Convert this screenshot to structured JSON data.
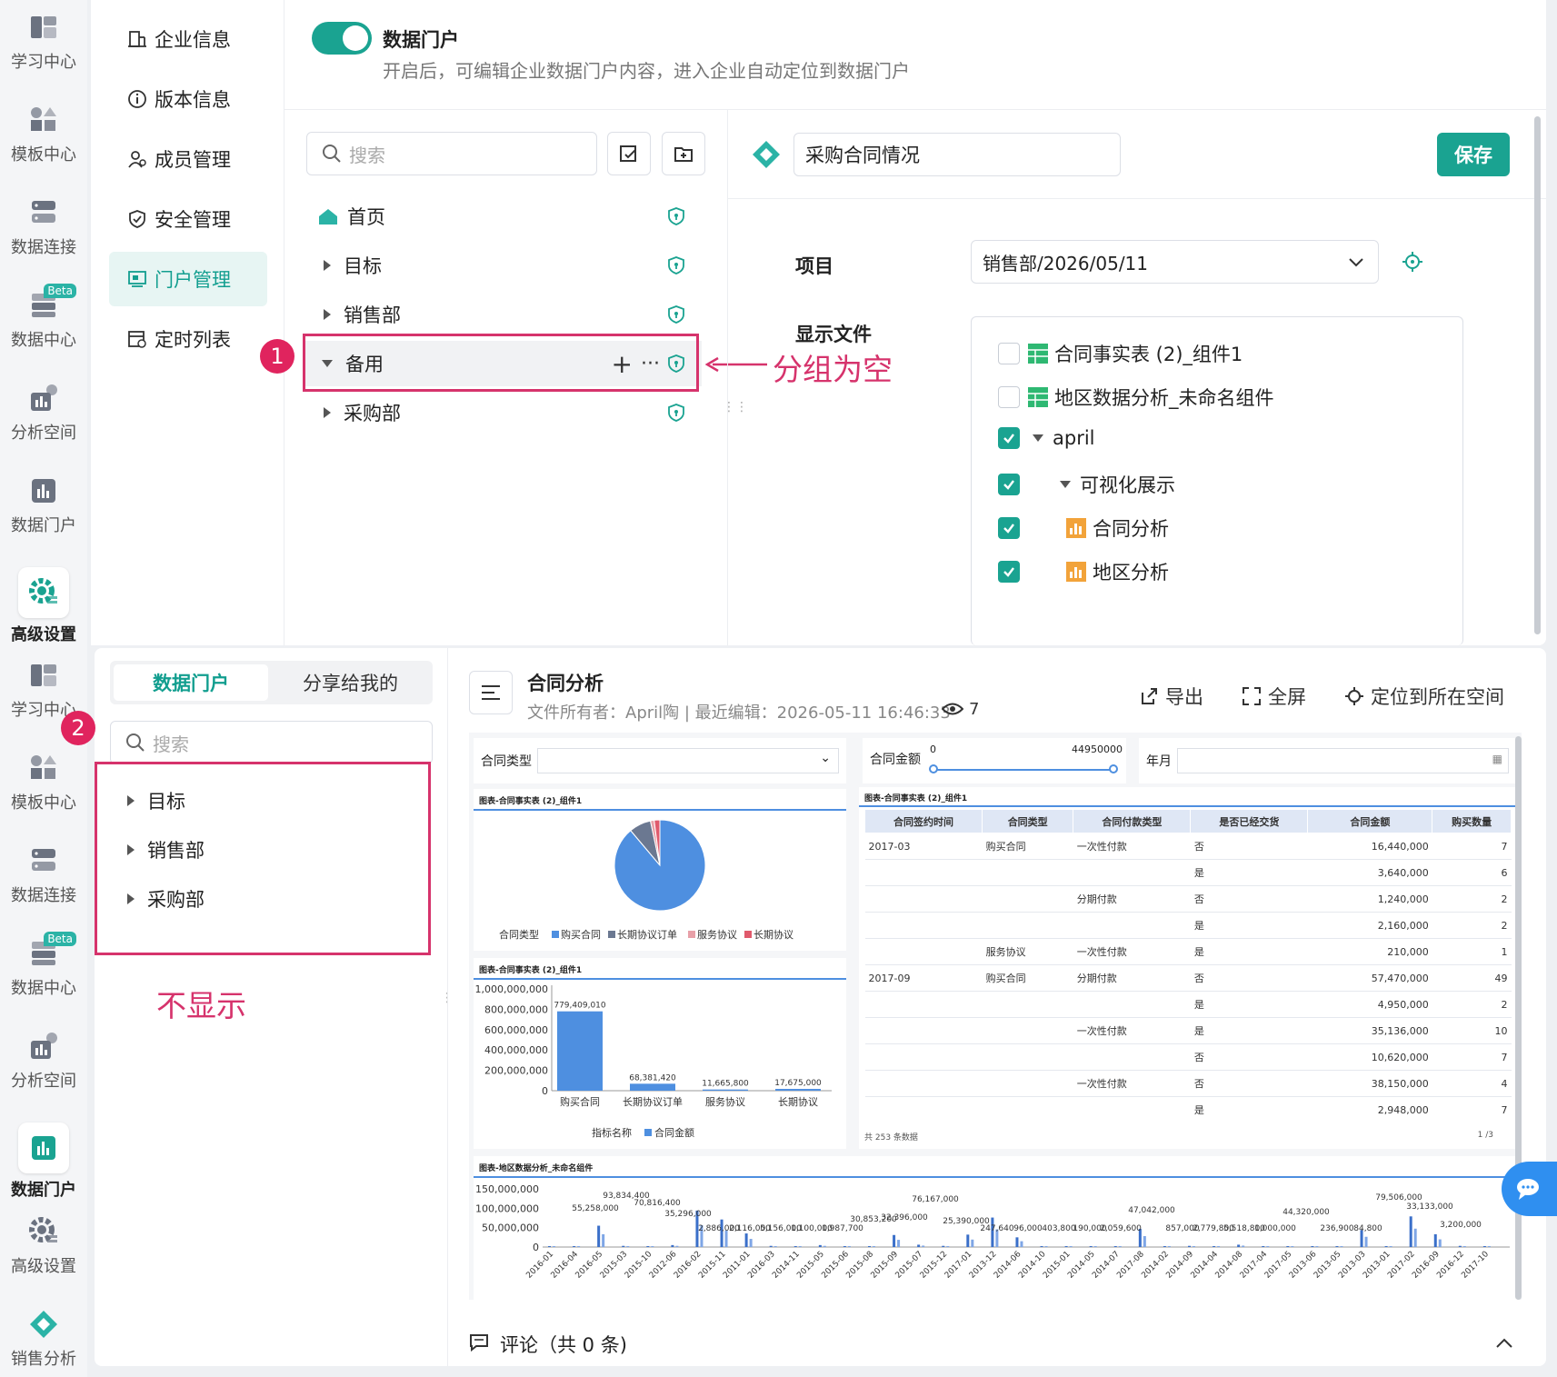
{
  "left_nav_top": [
    {
      "label": "学习中心",
      "icon": "book-icon"
    },
    {
      "label": "模板中心",
      "icon": "template-icon"
    },
    {
      "label": "数据连接",
      "icon": "database-icon"
    },
    {
      "label": "数据中心",
      "icon": "data-center-icon",
      "badge": "Beta"
    },
    {
      "label": "分析空间",
      "icon": "chart-icon"
    },
    {
      "label": "数据门户",
      "icon": "portal-icon"
    },
    {
      "label": "高级设置",
      "icon": "gear-icon"
    }
  ],
  "left_nav_bottom": [
    {
      "label": "学习中心",
      "icon": "book-icon"
    },
    {
      "label": "模板中心",
      "icon": "template-icon"
    },
    {
      "label": "数据连接",
      "icon": "database-icon"
    },
    {
      "label": "数据中心",
      "icon": "data-center-icon",
      "badge": "Beta"
    },
    {
      "label": "分析空间",
      "icon": "chart-icon"
    },
    {
      "label": "数据门户",
      "icon": "portal-icon"
    },
    {
      "label": "高级设置",
      "icon": "gear-icon"
    },
    {
      "label": "销售分析",
      "icon": "diamond-icon"
    }
  ],
  "settings_menu": [
    {
      "label": "企业信息",
      "icon": "building-icon"
    },
    {
      "label": "版本信息",
      "icon": "info-icon"
    },
    {
      "label": "成员管理",
      "icon": "user-icon"
    },
    {
      "label": "安全管理",
      "icon": "shield-icon"
    },
    {
      "label": "门户管理",
      "icon": "portal-icon"
    },
    {
      "label": "定时列表",
      "icon": "calendar-icon"
    }
  ],
  "portal_toggle": {
    "title": "数据门户",
    "desc": "开启后，可编辑企业数据门户内容，进入企业自动定位到数据门户"
  },
  "tree_search_placeholder": "搜索",
  "tree": [
    {
      "label": "首页"
    },
    {
      "label": "目标"
    },
    {
      "label": "销售部"
    },
    {
      "label": "备用"
    },
    {
      "label": "采购部"
    }
  ],
  "annotation1": {
    "num": "1",
    "text": "分组为空"
  },
  "page_name": "采购合同情况",
  "save_label": "保存",
  "project_label": "项目",
  "project_value": "销售部/2026/05/11",
  "display_files_label": "显示文件",
  "files": [
    {
      "label": "合同事实表 (2)_组件1",
      "checked": false
    },
    {
      "label": "地区数据分析_未命名组件",
      "checked": false
    },
    {
      "label": "april",
      "checked": true
    },
    {
      "label": "可视化展示",
      "checked": true
    },
    {
      "label": "合同分析",
      "checked": true
    },
    {
      "label": "地区分析",
      "checked": true
    }
  ],
  "portal_tabs": [
    "数据门户",
    "分享给我的"
  ],
  "portal_search_placeholder": "搜索",
  "portal_tree": [
    "目标",
    "销售部",
    "采购部"
  ],
  "annotation2": {
    "num": "2",
    "text": "不显示"
  },
  "report": {
    "title": "合同分析",
    "meta": "文件所有者：April陶 | 最近编辑：2026-05-11 16:46:33",
    "views": "7",
    "export": "导出",
    "fullscreen": "全屏",
    "locate": "定位到所在空间",
    "comment": "评论（共 0 条)"
  },
  "filters": {
    "type_label": "合同类型",
    "amount_label": "合同金额",
    "amount_min": "0",
    "amount_max": "44950000",
    "month_label": "年月"
  },
  "pie_chart": {
    "title": "图表-合同事实表 (2)_组件1",
    "legend_title": "合同类型",
    "chart_data": {
      "type": "pie",
      "labels": [
        "购买合同",
        "长期协议订单",
        "服务协议",
        "长期协议"
      ],
      "values": [
        779409010,
        68381420,
        11665800,
        17675000
      ],
      "colors": [
        "#4e8fe0",
        "#6b7891",
        "#e8a0a8",
        "#e05a6c"
      ]
    }
  },
  "bar_chart": {
    "title": "图表-合同事实表 (2)_组件1",
    "legend_x": "指标名称",
    "legend_series": "合同金额",
    "y_ticks": [
      "1,000,000,000",
      "800,000,000",
      "600,000,000",
      "400,000,000",
      "200,000,000",
      "0"
    ],
    "value_labels": [
      "779,409,010",
      "68,381,420",
      "11,665,800",
      "17,675,000"
    ],
    "chart_data": {
      "type": "bar",
      "categories": [
        "购买合同",
        "长期协议订单",
        "服务协议",
        "长期协议"
      ],
      "values": [
        779409010,
        68381420,
        11665800,
        17675000
      ],
      "ylim": [
        0,
        1000000000
      ]
    }
  },
  "table": {
    "title": "图表-合同事实表 (2)_组件1",
    "headers": [
      "合同签约时间",
      "合同类型",
      "合同付款类型",
      "是否已经交货",
      "合同金额",
      "购买数量"
    ],
    "rows": [
      [
        "2017-03",
        "购买合同",
        "一次性付款",
        "否",
        "16,440,000",
        "7"
      ],
      [
        "",
        "",
        "",
        "是",
        "3,640,000",
        "6"
      ],
      [
        "",
        "",
        "分期付款",
        "否",
        "1,240,000",
        "2"
      ],
      [
        "",
        "",
        "",
        "是",
        "2,160,000",
        "2"
      ],
      [
        "",
        "服务协议",
        "一次性付款",
        "是",
        "210,000",
        "1"
      ],
      [
        "2017-09",
        "购买合同",
        "分期付款",
        "否",
        "57,470,000",
        "49"
      ],
      [
        "",
        "",
        "",
        "是",
        "4,950,000",
        "2"
      ],
      [
        "",
        "",
        "一次性付款",
        "是",
        "35,136,000",
        "10"
      ],
      [
        "",
        "",
        "",
        "否",
        "10,620,000",
        "7"
      ],
      [
        "",
        "",
        "一次性付款",
        "否",
        "38,150,000",
        "4"
      ],
      [
        "",
        "",
        "",
        "是",
        "2,948,000",
        "7"
      ]
    ],
    "footer": "共 253 条数据",
    "pager": "1 /3"
  },
  "region_chart": {
    "title": "图表-地区数据分析_未命名组件",
    "y_ticks": [
      "150,000,000",
      "100,000,000",
      "50,000,000",
      "0"
    ],
    "value_labels": [
      "55,258,000",
      "93,834,400",
      "70,816,400",
      "35,296,000",
      "2,886,000",
      "2,116,000",
      "5,156,000",
      "1,100,000",
      "1,987,700",
      "30,853,200",
      "32,396,000",
      "76,167,000",
      "25,390,000",
      "247,640",
      "96,000",
      "403,800",
      "190,000",
      "2,059,600",
      "47,042,000",
      "857,000",
      "2,779,800",
      "5,518,800",
      "1,000,000",
      "44,320,000",
      "236,900",
      "84,800",
      "79,506,000",
      "33,133,000",
      "3,200,000"
    ],
    "x_labels": [
      "2016-01",
      "2016-04",
      "2016-05",
      "2015-03",
      "2015-10",
      "2012-06",
      "2016-02",
      "2015-11",
      "2011-01",
      "2016-03",
      "2014-11",
      "2015-05",
      "2015-06",
      "2015-08",
      "2015-09",
      "2015-07",
      "2015-12",
      "2017-01",
      "2013-12",
      "2014-06",
      "2014-10",
      "2015-01",
      "2014-05",
      "2014-07",
      "2017-08",
      "2014-02",
      "2014-09",
      "2014-04",
      "2014-08",
      "2017-04",
      "2017-05",
      "2013-06",
      "2013-05",
      "2013-03",
      "2013-01",
      "2017-02",
      "2016-09",
      "2016-12",
      "2017-10"
    ],
    "chart_data": {
      "type": "bar",
      "values": [
        1,
        2,
        55,
        3,
        2,
        5,
        94,
        71,
        35,
        3,
        2,
        5,
        1,
        2,
        31,
        6,
        3,
        32,
        76,
        25,
        2,
        1,
        1,
        2,
        47,
        1,
        3,
        2,
        6,
        1,
        0.2,
        0.1,
        0.1,
        44,
        1,
        79,
        33,
        3,
        1
      ]
    }
  },
  "colors": {
    "accent": "#1aa391",
    "pink": "#d6336c",
    "blue": "#4e8fe0"
  }
}
